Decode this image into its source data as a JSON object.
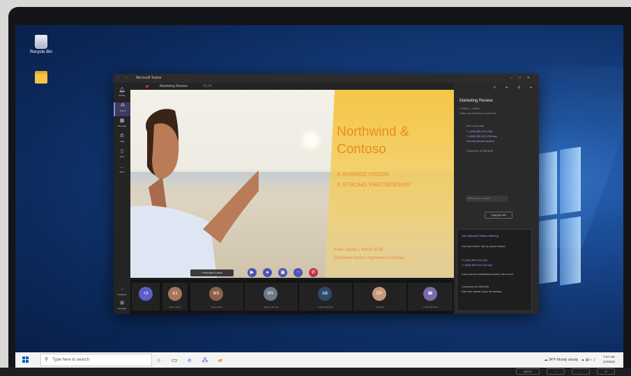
{
  "desktop": {
    "icons": [
      {
        "label": "Recycle Bin",
        "icon": "recycle-bin-icon"
      },
      {
        "label": "",
        "icon": "folder-icon"
      }
    ]
  },
  "teams": {
    "window_title": "Microsoft Teams",
    "rail": [
      {
        "label": "Activity",
        "icon": "bell-icon"
      },
      {
        "label": "Teams",
        "icon": "teams-icon"
      },
      {
        "label": "Meetings",
        "icon": "calendar-icon"
      },
      {
        "label": "Calls",
        "icon": "phone-icon"
      },
      {
        "label": "Files",
        "icon": "file-icon"
      },
      {
        "label": "More",
        "icon": "more-icon"
      }
    ],
    "rail_bottom": [
      {
        "label": "Feedback",
        "icon": "feedback-icon"
      },
      {
        "label": "Get Apps",
        "icon": "apps-icon"
      }
    ],
    "meeting": {
      "name": "Marketing Review",
      "elapsed": "00:24"
    },
    "slide": {
      "title_line1": "Northwind &",
      "title_line2": "Contoso",
      "sub_line1": "A SHARED VISION",
      "sub_line2": "A STRONG PARTNERSHIP",
      "foot_line1": "Katie Jordan | March 2016",
      "foot_line2": "Exclusive Partner Agreement Analysis"
    },
    "controls": {
      "presenting_label": "Presenter's slide"
    },
    "participants": [
      {
        "name": "",
        "initials": "+3"
      },
      {
        "name": "Katie Jordan",
        "initials": "KJ"
      },
      {
        "name": "Miguel Silva",
        "initials": "MS"
      },
      {
        "name": "Mateo Valencia",
        "initials": "MV"
      },
      {
        "name": "August Bergman",
        "initials": "AB"
      },
      {
        "name": "Eli Peña",
        "initials": "EP"
      },
      {
        "name": "+1 206 555 0131",
        "initials": "☎"
      }
    ],
    "details": {
      "title": "Marketing Review",
      "lines": [
        "10:00pm – 1:00pm",
        "Online and Conference room 20/4"
      ],
      "dial_label": "Dial in manually",
      "numbers": [
        "+1 (425) 555 0123 (Toll)",
        "+1 (866) 555 0123 (Toll free)",
        "Get international numbers"
      ],
      "conference_id": "Conference ID 568 8026",
      "phone_placeholder": "Enter phone number",
      "copy_label": "Copy join info",
      "card_title": "Join Microsoft Teams Meeting",
      "card_lines": [
        "Can't join online? Join by phone instead:",
        "+1 (425) 555 0123 (Toll)",
        "+1 (866) 555 0123 (Toll free)",
        "If you need an international number, see our list.",
        "Conference ID: 568 8026",
        "Enter this number to join the meeting."
      ]
    }
  },
  "taskbar": {
    "search_placeholder": "Type here to search",
    "weather": "34°F  Mostly cloudy",
    "time": "7:57 AM",
    "date": "1/4/2022"
  },
  "hardware": {
    "menu_label": "MENU"
  }
}
